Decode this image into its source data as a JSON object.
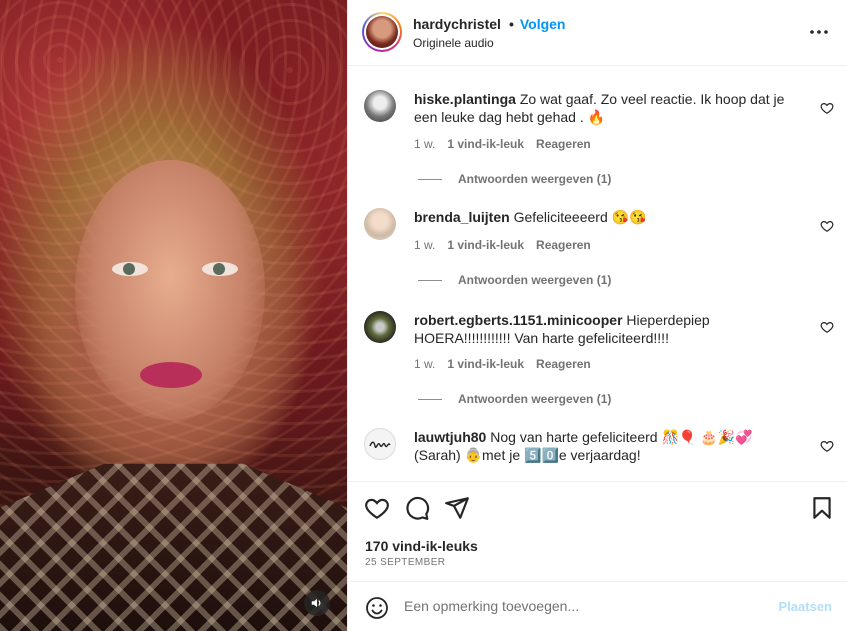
{
  "header": {
    "username": "hardychristel",
    "separator": "•",
    "follow_label": "Volgen",
    "audio": "Originele audio",
    "more_icon": "more-horizontal-icon"
  },
  "comments": [
    {
      "username": "hiske.plantinga",
      "text": "Zo wat gaaf. Zo veel reactie. Ik hoop dat je een leuke dag hebt gehad . 🔥",
      "time": "1 w.",
      "likes": "1 vind-ik-leuk",
      "reply": "Reageren",
      "view_replies": "Antwoorden weergeven (1)"
    },
    {
      "username": "brenda_luijten",
      "text": "Gefeliciteeeerd 😘😘",
      "time": "1 w.",
      "likes": "1 vind-ik-leuk",
      "reply": "Reageren",
      "view_replies": "Antwoorden weergeven (1)"
    },
    {
      "username": "robert.egberts.1151.minicooper",
      "text": "Hieperdepiep HOERA!!!!!!!!!!!! Van harte gefeliciteerd!!!!",
      "time": "1 w.",
      "likes": "1 vind-ik-leuk",
      "reply": "Reageren",
      "view_replies": "Antwoorden weergeven (1)"
    },
    {
      "username": "lauwtjuh80",
      "text": "Nog van harte gefeliciteerd 🎊🎈 🎂🎉💞 (Sarah) 👵met je 5️⃣0️⃣e verjaardag!"
    }
  ],
  "post": {
    "likes": "170 vind-ik-leuks",
    "date": "25 SEPTEMBER"
  },
  "add_comment": {
    "placeholder": "Een opmerking toevoegen...",
    "post_label": "Plaatsen"
  },
  "colors": {
    "accent": "#0095f6",
    "muted": "#737373",
    "post_disabled": "#b2dffc"
  }
}
